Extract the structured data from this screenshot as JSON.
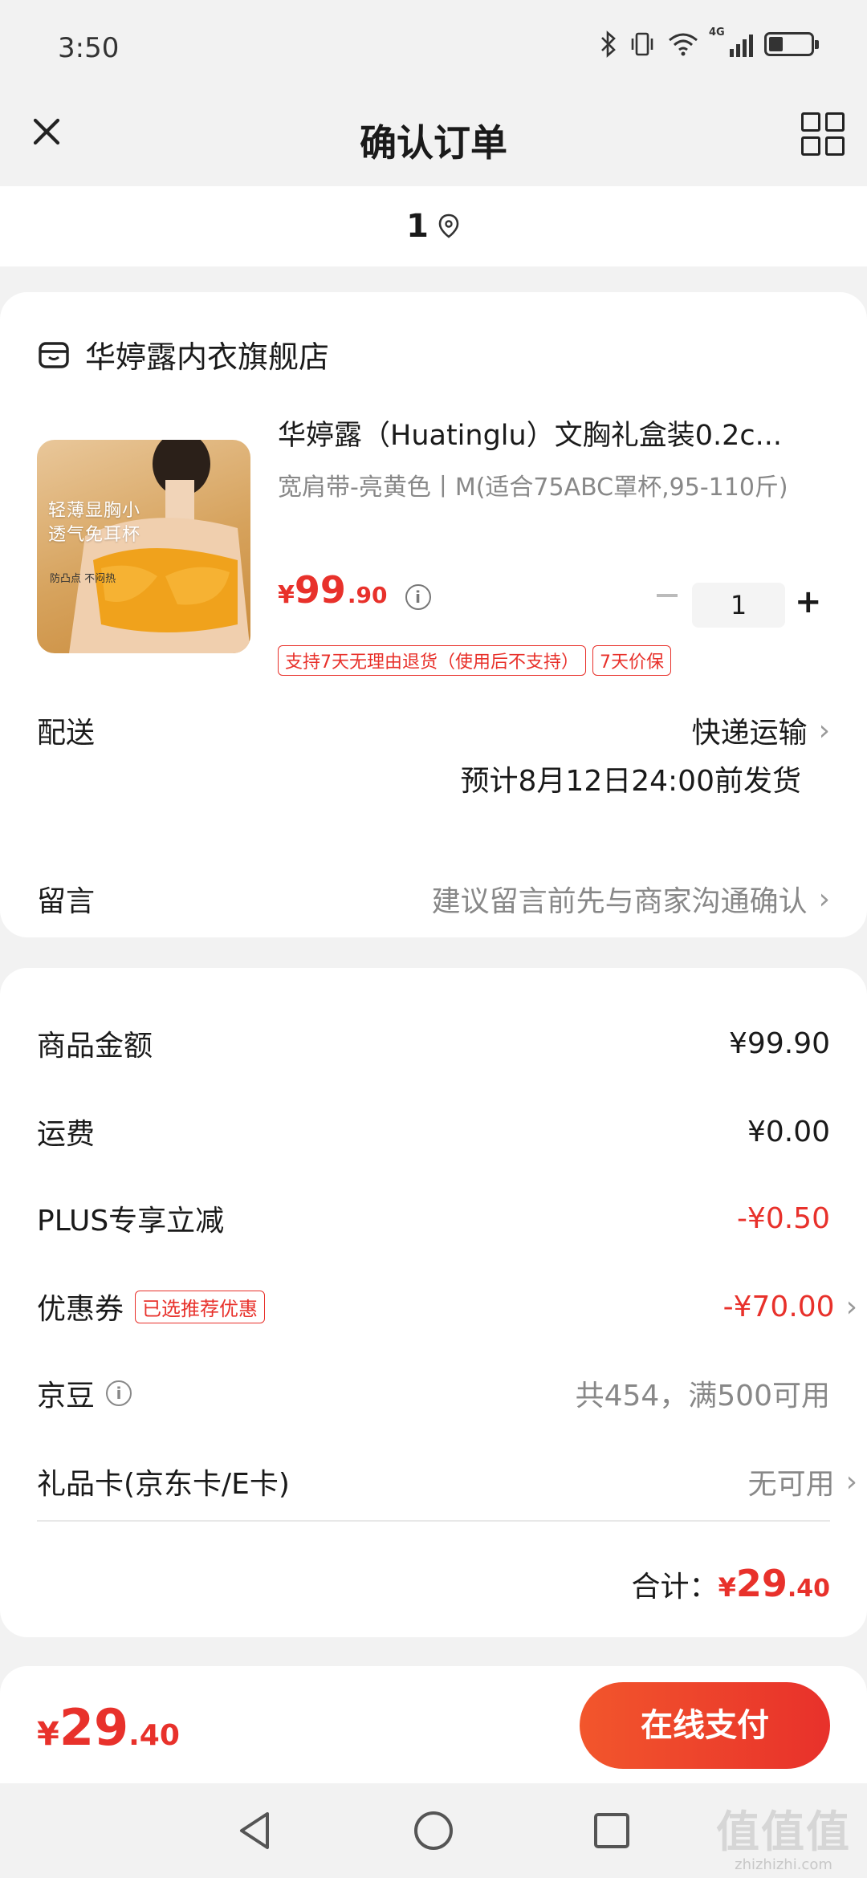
{
  "status_bar": {
    "time": "3:50",
    "network": "4G",
    "battery_level": 0.3
  },
  "header": {
    "title": "确认订单",
    "close_icon": "close-icon",
    "menu_icon": "grid-icon"
  },
  "address": {
    "text": "1"
  },
  "shop": {
    "name": "华婷露内衣旗舰店"
  },
  "product": {
    "image_text_1": "轻薄显胸小",
    "image_text_2": "透气免耳杯",
    "image_tag": "防凸点  不闷热",
    "title": "华婷露（Huatinglu）文胸礼盒装0.2c...",
    "spec": "宽肩带-亮黄色丨M(适合75ABC罩杯,95-110斤)",
    "price_symbol": "¥",
    "price_int": "99",
    "price_dec": ".90",
    "quantity": "1",
    "badges": [
      "支持7天无理由退货（使用后不支持）",
      "7天价保"
    ]
  },
  "delivery": {
    "label": "配送",
    "method": "快递运输",
    "eta": "预计8月12日24:00前发货"
  },
  "message": {
    "label": "留言",
    "placeholder": "建议留言前先与商家沟通确认"
  },
  "fees": {
    "goods_label": "商品金额",
    "goods_value": "¥99.90",
    "shipping_label": "运费",
    "shipping_value": "¥0.00",
    "plus_label": "PLUS专享立减",
    "plus_value": "-¥0.50",
    "coupon_label": "优惠券",
    "coupon_badge": "已选推荐优惠",
    "coupon_value": "-¥70.00",
    "beans_label": "京豆",
    "beans_value": "共454，满500可用",
    "giftcard_label": "礼品卡(京东卡/E卡)",
    "giftcard_value": "无可用",
    "total_label": "合计：",
    "total_symbol": "¥",
    "total_int": "29",
    "total_dec": ".40"
  },
  "paybar": {
    "symbol": "¥",
    "int": "29",
    "dec": ".40",
    "button": "在线支付"
  },
  "watermark": {
    "logo": "值值值",
    "url": "zhizhizhi.com"
  },
  "colors": {
    "accent": "#e8312b",
    "background": "#f2f2f2"
  }
}
